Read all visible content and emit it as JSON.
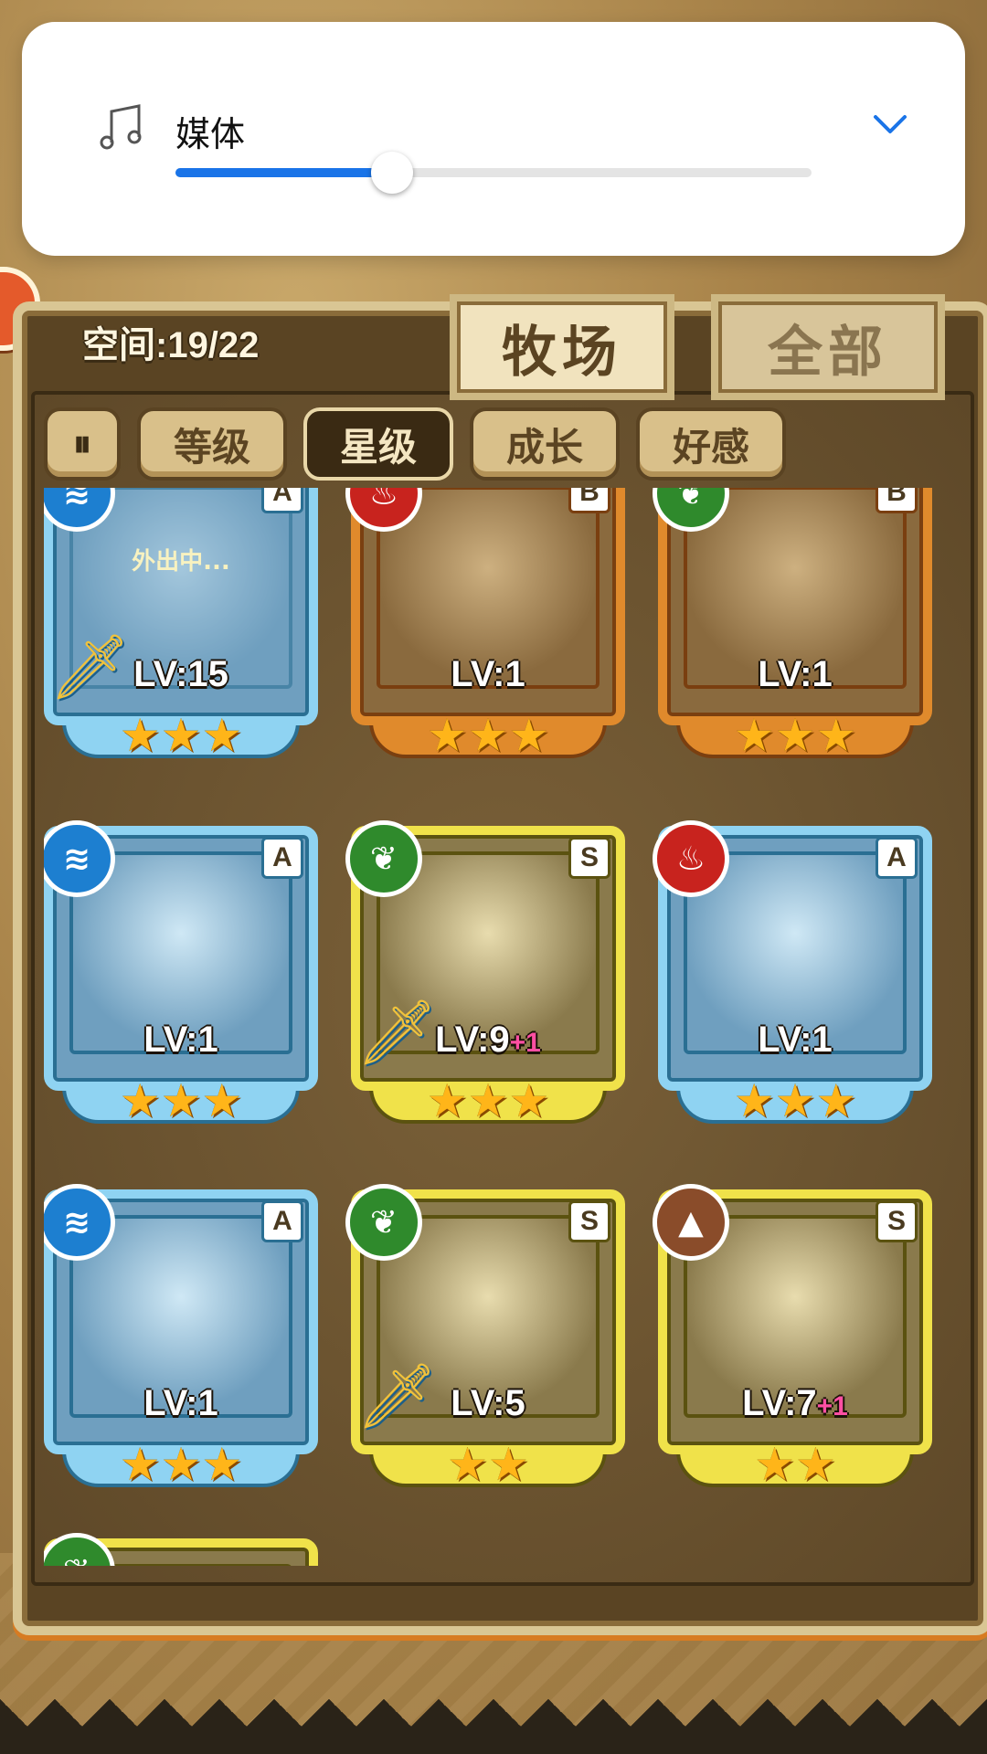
{
  "volume": {
    "label": "媒体",
    "icon": "music-note-icon",
    "level": 0.34,
    "accent": "#1a74e8"
  },
  "header": {
    "space_label": "空间:19/22",
    "tabs": [
      {
        "label": "牧场",
        "active": true
      },
      {
        "label": "全部",
        "active": false
      }
    ]
  },
  "sort_buttons": [
    {
      "label": "⏸",
      "icon": "pause-order-icon",
      "active": false
    },
    {
      "label": "等级",
      "active": false
    },
    {
      "label": "星级",
      "active": true
    },
    {
      "label": "成长",
      "active": false
    },
    {
      "label": "好感",
      "active": false
    }
  ],
  "cards": [
    {
      "element": "water",
      "element_glyph": "≋",
      "rank": "A",
      "level": "LV:15",
      "plus": "",
      "stars": "★★★",
      "frame": "blue",
      "weapon": true,
      "status": "外出中..."
    },
    {
      "element": "fire",
      "element_glyph": "♨",
      "rank": "B",
      "level": "LV:1",
      "plus": "",
      "stars": "★★★",
      "frame": "orange",
      "weapon": false,
      "status": ""
    },
    {
      "element": "wood",
      "element_glyph": "❦",
      "rank": "B",
      "level": "LV:1",
      "plus": "",
      "stars": "★★★",
      "frame": "orange",
      "weapon": false,
      "status": ""
    },
    {
      "element": "water",
      "element_glyph": "≋",
      "rank": "A",
      "level": "LV:1",
      "plus": "",
      "stars": "★★★",
      "frame": "blue",
      "weapon": false,
      "status": ""
    },
    {
      "element": "wood",
      "element_glyph": "❦",
      "rank": "S",
      "level": "LV:9",
      "plus": "+1",
      "stars": "★★★",
      "frame": "gold",
      "weapon": true,
      "status": ""
    },
    {
      "element": "fire",
      "element_glyph": "♨",
      "rank": "A",
      "level": "LV:1",
      "plus": "",
      "stars": "★★★",
      "frame": "blue",
      "weapon": false,
      "status": ""
    },
    {
      "element": "water",
      "element_glyph": "≋",
      "rank": "A",
      "level": "LV:1",
      "plus": "",
      "stars": "★★★",
      "frame": "blue",
      "weapon": false,
      "status": ""
    },
    {
      "element": "wood",
      "element_glyph": "❦",
      "rank": "S",
      "level": "LV:5",
      "plus": "",
      "stars": "★★",
      "frame": "gold",
      "weapon": true,
      "status": ""
    },
    {
      "element": "earth",
      "element_glyph": "▲",
      "rank": "S",
      "level": "LV:7",
      "plus": "+1",
      "stars": "★★",
      "frame": "gold",
      "weapon": false,
      "status": ""
    },
    {
      "element": "wood",
      "element_glyph": "❦",
      "rank": "",
      "level": "",
      "plus": "",
      "stars": "",
      "frame": "gold",
      "weapon": false,
      "status": ""
    }
  ],
  "colors": {
    "frame_blue": "#8fd3f2",
    "frame_orange": "#e08a2c",
    "frame_gold": "#f0e24a"
  }
}
